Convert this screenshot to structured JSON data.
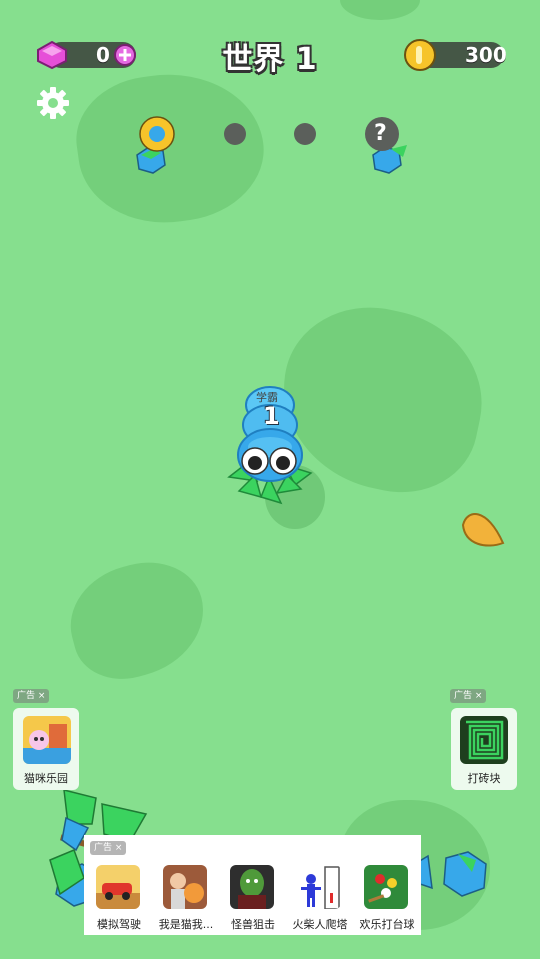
{
  "hud": {
    "gems": "0",
    "coins": "300",
    "title": "世界 1"
  },
  "progress": {
    "locked_stage_symbol": "?"
  },
  "player": {
    "name": "学霸",
    "level": "1"
  },
  "ads": {
    "tag": "广告",
    "close": "×",
    "left": {
      "label": "猫咪乐园"
    },
    "right": {
      "label": "打砖块"
    },
    "bottom": [
      {
        "label": "模拟驾驶"
      },
      {
        "label": "我是猫我..."
      },
      {
        "label": "怪兽狙击"
      },
      {
        "label": "火柴人爬塔"
      },
      {
        "label": "欢乐打台球"
      }
    ]
  },
  "colors": {
    "ground": "#86df8e",
    "patch": "#74cf7b",
    "gem": "#e64fd8",
    "coin": "#f6c42a",
    "snake": "#37a8ea"
  }
}
